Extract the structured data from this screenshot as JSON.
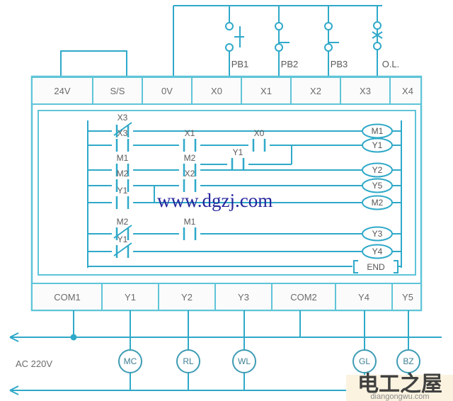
{
  "diagram": {
    "title": "PLC wiring and ladder diagram",
    "colors": {
      "wire": "#2fa9c9",
      "wire_light": "#72c8dc",
      "frame": "#5ec4d8",
      "terminal_fill": "#fbfbfb",
      "label_gray": "#5a5a5a",
      "watermark_blue": "#26269c",
      "watermark_bg": "#fbf3e0"
    },
    "input_devices": [
      {
        "name": "PB1",
        "type": "normally-open-pushbutton",
        "terminal": "X0"
      },
      {
        "name": "PB2",
        "type": "normally-closed-pushbutton",
        "terminal": "X1"
      },
      {
        "name": "PB3",
        "type": "normally-closed-pushbutton",
        "terminal": "X2"
      },
      {
        "name": "O.L.",
        "type": "overload-contact",
        "terminal": "X3"
      }
    ],
    "top_terminals": [
      "24V",
      "S/S",
      "0V",
      "X0",
      "X1",
      "X2",
      "X3",
      "X4"
    ],
    "bottom_terminals": [
      "COM1",
      "Y1",
      "Y2",
      "Y3",
      "COM2",
      "Y4",
      "Y5"
    ],
    "output_loads": [
      {
        "name": "MC",
        "terminal": "Y1"
      },
      {
        "name": "RL",
        "terminal": "Y2"
      },
      {
        "name": "WL",
        "terminal": "Y3"
      },
      {
        "name": "GL",
        "terminal": "Y4"
      },
      {
        "name": "BZ",
        "terminal": "Y5"
      }
    ],
    "power_label": "AC 220V",
    "jumper_note": "24V to S/S link",
    "ladder": {
      "rungs": [
        {
          "index": 1,
          "contacts": [
            {
              "label": "X3",
              "type": "NC",
              "col": 1
            }
          ],
          "coil": "M1"
        },
        {
          "index": 2,
          "contacts": [
            {
              "label": "X3",
              "type": "NO",
              "col": 1
            },
            {
              "label": "X1",
              "type": "NO",
              "col": 2
            },
            {
              "label": "X0",
              "type": "NO",
              "col": 3
            }
          ],
          "coil": "Y1"
        },
        {
          "index": 3,
          "contacts": [
            {
              "label": "M1",
              "type": "NO",
              "col": 1
            },
            {
              "label": "M2",
              "type": "NO",
              "col": 2
            },
            {
              "label": "Y1",
              "type": "NO",
              "col": 3
            }
          ],
          "coil": "Y2"
        },
        {
          "index": 4,
          "contacts": [
            {
              "label": "M2",
              "type": "NO",
              "col": 1
            },
            {
              "label": "X2",
              "type": "NO",
              "col": 2
            }
          ],
          "coil": "Y5"
        },
        {
          "index": 5,
          "contacts": [
            {
              "label": "Y1",
              "type": "NO",
              "col": 1
            }
          ],
          "coil": "M2"
        },
        {
          "index": 6,
          "contacts": [
            {
              "label": "M2",
              "type": "NC",
              "col": 1
            },
            {
              "label": "M1",
              "type": "NO",
              "col": 2
            }
          ],
          "coil": "Y3"
        },
        {
          "index": 7,
          "contacts": [
            {
              "label": "Y1",
              "type": "NC",
              "col": 1
            }
          ],
          "coil": "Y4"
        }
      ],
      "coils": [
        "M1",
        "Y1",
        "Y2",
        "Y5",
        "M2",
        "Y3",
        "Y4"
      ],
      "end_label": "END"
    },
    "watermarks": {
      "center": "www.dgzj.com",
      "corner_cn": "电工之屋",
      "corner_url": "diangongwu.com"
    }
  }
}
